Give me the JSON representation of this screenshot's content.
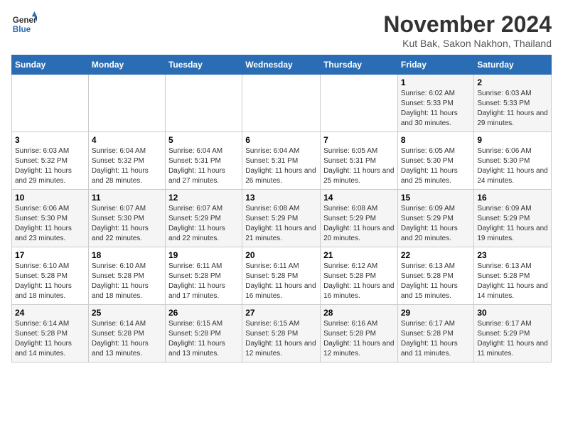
{
  "logo": {
    "line1": "General",
    "line2": "Blue"
  },
  "title": "November 2024",
  "subtitle": "Kut Bak, Sakon Nakhon, Thailand",
  "days_of_week": [
    "Sunday",
    "Monday",
    "Tuesday",
    "Wednesday",
    "Thursday",
    "Friday",
    "Saturday"
  ],
  "weeks": [
    [
      {
        "day": "",
        "info": ""
      },
      {
        "day": "",
        "info": ""
      },
      {
        "day": "",
        "info": ""
      },
      {
        "day": "",
        "info": ""
      },
      {
        "day": "",
        "info": ""
      },
      {
        "day": "1",
        "info": "Sunrise: 6:02 AM\nSunset: 5:33 PM\nDaylight: 11 hours and 30 minutes."
      },
      {
        "day": "2",
        "info": "Sunrise: 6:03 AM\nSunset: 5:33 PM\nDaylight: 11 hours and 29 minutes."
      }
    ],
    [
      {
        "day": "3",
        "info": "Sunrise: 6:03 AM\nSunset: 5:32 PM\nDaylight: 11 hours and 29 minutes."
      },
      {
        "day": "4",
        "info": "Sunrise: 6:04 AM\nSunset: 5:32 PM\nDaylight: 11 hours and 28 minutes."
      },
      {
        "day": "5",
        "info": "Sunrise: 6:04 AM\nSunset: 5:31 PM\nDaylight: 11 hours and 27 minutes."
      },
      {
        "day": "6",
        "info": "Sunrise: 6:04 AM\nSunset: 5:31 PM\nDaylight: 11 hours and 26 minutes."
      },
      {
        "day": "7",
        "info": "Sunrise: 6:05 AM\nSunset: 5:31 PM\nDaylight: 11 hours and 25 minutes."
      },
      {
        "day": "8",
        "info": "Sunrise: 6:05 AM\nSunset: 5:30 PM\nDaylight: 11 hours and 25 minutes."
      },
      {
        "day": "9",
        "info": "Sunrise: 6:06 AM\nSunset: 5:30 PM\nDaylight: 11 hours and 24 minutes."
      }
    ],
    [
      {
        "day": "10",
        "info": "Sunrise: 6:06 AM\nSunset: 5:30 PM\nDaylight: 11 hours and 23 minutes."
      },
      {
        "day": "11",
        "info": "Sunrise: 6:07 AM\nSunset: 5:30 PM\nDaylight: 11 hours and 22 minutes."
      },
      {
        "day": "12",
        "info": "Sunrise: 6:07 AM\nSunset: 5:29 PM\nDaylight: 11 hours and 22 minutes."
      },
      {
        "day": "13",
        "info": "Sunrise: 6:08 AM\nSunset: 5:29 PM\nDaylight: 11 hours and 21 minutes."
      },
      {
        "day": "14",
        "info": "Sunrise: 6:08 AM\nSunset: 5:29 PM\nDaylight: 11 hours and 20 minutes."
      },
      {
        "day": "15",
        "info": "Sunrise: 6:09 AM\nSunset: 5:29 PM\nDaylight: 11 hours and 20 minutes."
      },
      {
        "day": "16",
        "info": "Sunrise: 6:09 AM\nSunset: 5:29 PM\nDaylight: 11 hours and 19 minutes."
      }
    ],
    [
      {
        "day": "17",
        "info": "Sunrise: 6:10 AM\nSunset: 5:28 PM\nDaylight: 11 hours and 18 minutes."
      },
      {
        "day": "18",
        "info": "Sunrise: 6:10 AM\nSunset: 5:28 PM\nDaylight: 11 hours and 18 minutes."
      },
      {
        "day": "19",
        "info": "Sunrise: 6:11 AM\nSunset: 5:28 PM\nDaylight: 11 hours and 17 minutes."
      },
      {
        "day": "20",
        "info": "Sunrise: 6:11 AM\nSunset: 5:28 PM\nDaylight: 11 hours and 16 minutes."
      },
      {
        "day": "21",
        "info": "Sunrise: 6:12 AM\nSunset: 5:28 PM\nDaylight: 11 hours and 16 minutes."
      },
      {
        "day": "22",
        "info": "Sunrise: 6:13 AM\nSunset: 5:28 PM\nDaylight: 11 hours and 15 minutes."
      },
      {
        "day": "23",
        "info": "Sunrise: 6:13 AM\nSunset: 5:28 PM\nDaylight: 11 hours and 14 minutes."
      }
    ],
    [
      {
        "day": "24",
        "info": "Sunrise: 6:14 AM\nSunset: 5:28 PM\nDaylight: 11 hours and 14 minutes."
      },
      {
        "day": "25",
        "info": "Sunrise: 6:14 AM\nSunset: 5:28 PM\nDaylight: 11 hours and 13 minutes."
      },
      {
        "day": "26",
        "info": "Sunrise: 6:15 AM\nSunset: 5:28 PM\nDaylight: 11 hours and 13 minutes."
      },
      {
        "day": "27",
        "info": "Sunrise: 6:15 AM\nSunset: 5:28 PM\nDaylight: 11 hours and 12 minutes."
      },
      {
        "day": "28",
        "info": "Sunrise: 6:16 AM\nSunset: 5:28 PM\nDaylight: 11 hours and 12 minutes."
      },
      {
        "day": "29",
        "info": "Sunrise: 6:17 AM\nSunset: 5:28 PM\nDaylight: 11 hours and 11 minutes."
      },
      {
        "day": "30",
        "info": "Sunrise: 6:17 AM\nSunset: 5:29 PM\nDaylight: 11 hours and 11 minutes."
      }
    ]
  ]
}
